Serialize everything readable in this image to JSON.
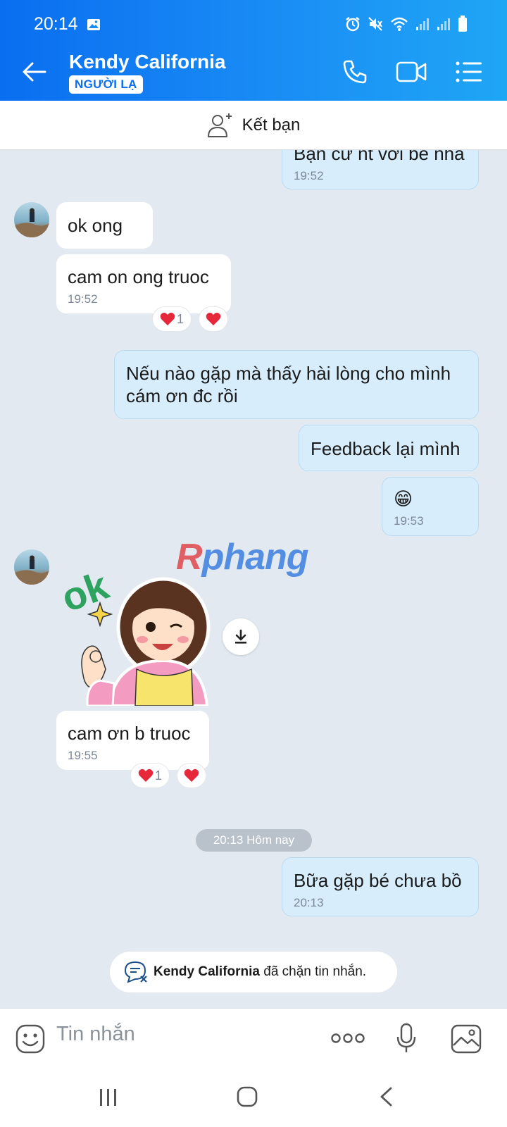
{
  "status_bar": {
    "time": "20:14"
  },
  "header": {
    "contact_name": "Kendy California",
    "badge": "NGƯỜI LẠ",
    "accent": "#0a6ef0"
  },
  "add_friend": {
    "label": "Kết bạn"
  },
  "messages": [
    {
      "sender": "me",
      "text": "Bạn cư nt với bé nha",
      "time": "19:52"
    },
    {
      "sender": "them",
      "text": "ok ong"
    },
    {
      "sender": "them",
      "text": "cam on ong truoc",
      "time": "19:52",
      "reaction_count": "1"
    },
    {
      "sender": "me",
      "text_lines": [
        "Nếu nào gặp mà thấy hài lòng cho mình",
        "cám ơn đc rồi"
      ]
    },
    {
      "sender": "me",
      "text": "Feedback lại mình"
    },
    {
      "sender": "me",
      "text": "😁",
      "time": "19:53"
    },
    {
      "sender": "them",
      "type": "sticker",
      "sticker_text": "ok"
    },
    {
      "sender": "them",
      "text": "cam ơn b truoc",
      "time": "19:55",
      "reaction_count": "1"
    },
    {
      "sender": "me",
      "text": "Bữa gặp bé chưa bồ",
      "time": "20:13"
    }
  ],
  "date_divider": "20:13 Hôm nay",
  "blocked_notice": {
    "name": "Kendy California",
    "suffix": " đã chặn tin nhắn."
  },
  "watermark": {
    "lead": "R",
    "rest": "phang"
  },
  "composer": {
    "placeholder": "Tin nhắn"
  },
  "icons": [
    "back-arrow-icon",
    "phone-icon",
    "video-icon",
    "menu-list-icon",
    "add-friend-icon",
    "emoji-icon",
    "more-icon",
    "mic-icon",
    "image-icon",
    "download-icon",
    "heart-icon"
  ]
}
